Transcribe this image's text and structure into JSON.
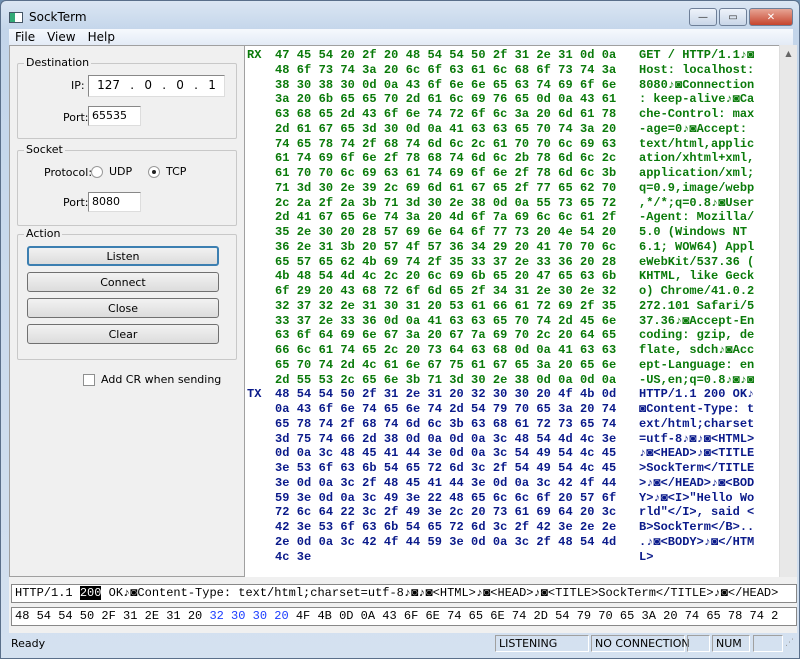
{
  "window": {
    "title": "SockTerm",
    "minimize": "—",
    "maximize": "▭",
    "close": "✕"
  },
  "menu": [
    "File",
    "View",
    "Help"
  ],
  "destination": {
    "legend": "Destination",
    "ip_label": "IP:",
    "ip": [
      "127",
      "0",
      "0",
      "1"
    ],
    "port_label": "Port:",
    "port": "65535"
  },
  "socket": {
    "legend": "Socket",
    "protocol_label": "Protocol:",
    "udp": "UDP",
    "tcp": "TCP",
    "selected": "TCP",
    "port_label": "Port:",
    "port": "8080"
  },
  "action": {
    "legend": "Action",
    "listen": "Listen",
    "connect": "Connect",
    "close": "Close",
    "clear": "Clear",
    "add_cr": "Add CR when sending",
    "add_cr_checked": false
  },
  "dump": {
    "rx_tag": "RX",
    "tx_tag": "TX",
    "rx_color": "#0a7a0a",
    "tx_color": "#0a1a8a",
    "rx": [
      [
        "47 45 54 20 2f 20 48 54 54 50 2f 31 2e 31 0d 0a",
        "GET / HTTP/1.1♪◙"
      ],
      [
        "48 6f 73 74 3a 20 6c 6f 63 61 6c 68 6f 73 74 3a",
        "Host: localhost:"
      ],
      [
        "38 30 38 30 0d 0a 43 6f 6e 6e 65 63 74 69 6f 6e",
        "8080♪◙Connection"
      ],
      [
        "3a 20 6b 65 65 70 2d 61 6c 69 76 65 0d 0a 43 61",
        ": keep-alive♪◙Ca"
      ],
      [
        "63 68 65 2d 43 6f 6e 74 72 6f 6c 3a 20 6d 61 78",
        "che-Control: max"
      ],
      [
        "2d 61 67 65 3d 30 0d 0a 41 63 63 65 70 74 3a 20",
        "-age=0♪◙Accept: "
      ],
      [
        "74 65 78 74 2f 68 74 6d 6c 2c 61 70 70 6c 69 63",
        "text/html,applic"
      ],
      [
        "61 74 69 6f 6e 2f 78 68 74 6d 6c 2b 78 6d 6c 2c",
        "ation/xhtml+xml,"
      ],
      [
        "61 70 70 6c 69 63 61 74 69 6f 6e 2f 78 6d 6c 3b",
        "application/xml;"
      ],
      [
        "71 3d 30 2e 39 2c 69 6d 61 67 65 2f 77 65 62 70",
        "q=0.9,image/webp"
      ],
      [
        "2c 2a 2f 2a 3b 71 3d 30 2e 38 0d 0a 55 73 65 72",
        ",*/*;q=0.8♪◙User"
      ],
      [
        "2d 41 67 65 6e 74 3a 20 4d 6f 7a 69 6c 6c 61 2f",
        "-Agent: Mozilla/"
      ],
      [
        "35 2e 30 20 28 57 69 6e 64 6f 77 73 20 4e 54 20",
        "5.0 (Windows NT "
      ],
      [
        "36 2e 31 3b 20 57 4f 57 36 34 29 20 41 70 70 6c",
        "6.1; WOW64) Appl"
      ],
      [
        "65 57 65 62 4b 69 74 2f 35 33 37 2e 33 36 20 28",
        "eWebKit/537.36 ("
      ],
      [
        "4b 48 54 4d 4c 2c 20 6c 69 6b 65 20 47 65 63 6b",
        "KHTML, like Geck"
      ],
      [
        "6f 29 20 43 68 72 6f 6d 65 2f 34 31 2e 30 2e 32",
        "o) Chrome/41.0.2"
      ],
      [
        "32 37 32 2e 31 30 31 20 53 61 66 61 72 69 2f 35",
        "272.101 Safari/5"
      ],
      [
        "33 37 2e 33 36 0d 0a 41 63 63 65 70 74 2d 45 6e",
        "37.36♪◙Accept-En"
      ],
      [
        "63 6f 64 69 6e 67 3a 20 67 7a 69 70 2c 20 64 65",
        "coding: gzip, de"
      ],
      [
        "66 6c 61 74 65 2c 20 73 64 63 68 0d 0a 41 63 63",
        "flate, sdch♪◙Acc"
      ],
      [
        "65 70 74 2d 4c 61 6e 67 75 61 67 65 3a 20 65 6e",
        "ept-Language: en"
      ],
      [
        "2d 55 53 2c 65 6e 3b 71 3d 30 2e 38 0d 0a 0d 0a",
        "-US,en;q=0.8♪◙♪◙"
      ]
    ],
    "tx": [
      [
        "48 54 54 50 2f 31 2e 31 20 32 30 30 20 4f 4b 0d",
        "HTTP/1.1 200 OK♪"
      ],
      [
        "0a 43 6f 6e 74 65 6e 74 2d 54 79 70 65 3a 20 74",
        "◙Content-Type: t"
      ],
      [
        "65 78 74 2f 68 74 6d 6c 3b 63 68 61 72 73 65 74",
        "ext/html;charset"
      ],
      [
        "3d 75 74 66 2d 38 0d 0a 0d 0a 3c 48 54 4d 4c 3e",
        "=utf-8♪◙♪◙<HTML>"
      ],
      [
        "0d 0a 3c 48 45 41 44 3e 0d 0a 3c 54 49 54 4c 45",
        "♪◙<HEAD>♪◙<TITLE"
      ],
      [
        "3e 53 6f 63 6b 54 65 72 6d 3c 2f 54 49 54 4c 45",
        ">SockTerm</TITLE"
      ],
      [
        "3e 0d 0a 3c 2f 48 45 41 44 3e 0d 0a 3c 42 4f 44",
        ">♪◙</HEAD>♪◙<BOD"
      ],
      [
        "59 3e 0d 0a 3c 49 3e 22 48 65 6c 6c 6f 20 57 6f",
        "Y>♪◙<I>\"Hello Wo"
      ],
      [
        "72 6c 64 22 3c 2f 49 3e 2c 20 73 61 69 64 20 3c",
        "rld\"</I>, said <"
      ],
      [
        "42 3e 53 6f 63 6b 54 65 72 6d 3c 2f 42 3e 2e 2e",
        "B>SockTerm</B>.."
      ],
      [
        "2e 0d 0a 3c 42 4f 44 59 3e 0d 0a 3c 2f 48 54 4d",
        ".♪◙<BODY>♪◙</HTM"
      ],
      [
        "4c 3e",
        "L>"
      ]
    ]
  },
  "send": {
    "before": "HTTP/1.1 ",
    "selected": "200",
    "after": " OK♪◙Content-Type: text/html;charset=utf-8♪◙♪◙<HTML>♪◙<HEAD>♪◙<TITLE>SockTerm</TITLE>♪◙</HEAD>"
  },
  "send_hex": {
    "before": "48 54 54 50 2F 31 2E 31 20 ",
    "highlight": "32 30 30 20",
    "after": " 4F 4B 0D 0A 43 6F 6E 74 65 6E 74 2D 54 79 70 65 3A 20 74 65 78 74 2",
    "highlight_color": "#1a3cff"
  },
  "status": {
    "text": "Ready",
    "listening": "LISTENING",
    "connection": "NO CONNECTION",
    "num": "NUM"
  }
}
